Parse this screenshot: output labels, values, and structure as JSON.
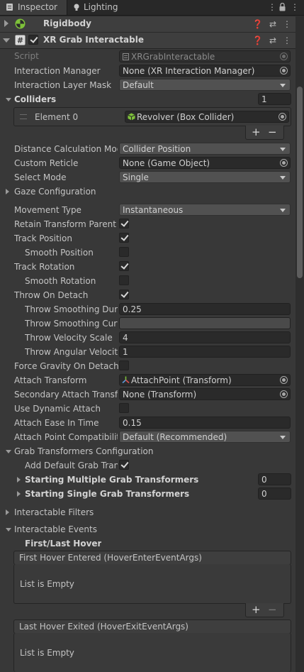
{
  "tabs": {
    "inspector": "Inspector",
    "lighting": "Lighting"
  },
  "rigidbody": {
    "title": "Rigidbody"
  },
  "xr": {
    "title": "XR Grab Interactable",
    "script_label": "Script",
    "script_value": "XRGrabInteractable",
    "rows": [
      {
        "label": "Interaction Manager",
        "value": "None (XR Interaction Manager)"
      },
      {
        "label": "Interaction Layer Mask",
        "value": "Default"
      }
    ],
    "colliders": {
      "label": "Colliders",
      "count": "1",
      "element_label": "Element 0",
      "element_value": "Revolver (Box Collider)"
    },
    "rows2": [
      {
        "label": "Distance Calculation Mod",
        "value": "Collider Position"
      },
      {
        "label": "Custom Reticle",
        "value": "None (Game Object)"
      },
      {
        "label": "Select Mode",
        "value": "Single"
      }
    ],
    "gaze": "Gaze Configuration",
    "movement_type": {
      "label": "Movement Type",
      "value": "Instantaneous"
    },
    "checks": [
      {
        "label": "Retain Transform Parent"
      },
      {
        "label": "Track Position"
      },
      {
        "label": "Smooth Position"
      },
      {
        "label": "Track Rotation"
      },
      {
        "label": "Smooth Rotation"
      },
      {
        "label": "Throw On Detach"
      }
    ],
    "throw": [
      {
        "label": "Throw Smoothing Durat",
        "value": "0.25"
      },
      {
        "label": "Throw Smoothing Curve",
        "value": ""
      },
      {
        "label": "Throw Velocity Scale",
        "value": "4"
      },
      {
        "label": "Throw Angular Velocity",
        "value": "1"
      }
    ],
    "force_gravity": "Force Gravity On Detach",
    "attach_transform": {
      "label": "Attach Transform",
      "value": "AttachPoint (Transform)"
    },
    "secondary_attach": {
      "label": "Secondary Attach Transfo",
      "value": "None (Transform)"
    },
    "use_dynamic": "Use Dynamic Attach",
    "attach_ease": {
      "label": "Attach Ease In Time",
      "value": "0.15"
    },
    "attach_compat": {
      "label": "Attach Point Compatibility",
      "value": "Default (Recommended)"
    },
    "grab_config": "Grab Transformers Configuration",
    "add_default": "Add Default Grab Trans",
    "starting_multiple": {
      "label": "Starting Multiple Grab Transformers",
      "value": "0"
    },
    "starting_single": {
      "label": "Starting Single Grab Transformers",
      "value": "0"
    },
    "filters": "Interactable Filters",
    "events": "Interactable Events",
    "first_last": "First/Last Hover",
    "first_hover": {
      "title": "First Hover Entered (HoverEnterEventArgs)",
      "empty": "List is Empty"
    },
    "last_hover": {
      "title": "Last Hover Exited (HoverExitEventArgs)",
      "empty": "List is Empty"
    },
    "plus": "+",
    "minus": "−"
  }
}
